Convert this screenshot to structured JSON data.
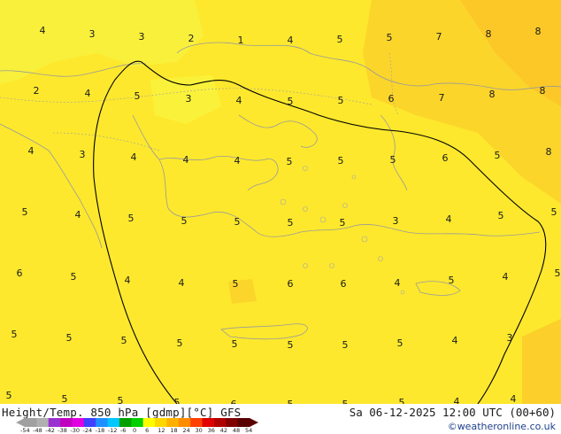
{
  "map": {
    "title": "Height/Temp. 850 hPa [gdmp][°C] GFS",
    "valid_time": "Sa 06-12-2025 12:00 UTC (00+60)",
    "credit": "©weatheronline.co.uk",
    "labels": [
      {
        "t": "4"
      },
      {
        "t": "3"
      },
      {
        "t": "3"
      },
      {
        "t": "2"
      },
      {
        "t": "1"
      },
      {
        "t": "4"
      },
      {
        "t": "5"
      },
      {
        "t": "5"
      },
      {
        "t": "7"
      },
      {
        "t": "8"
      },
      {
        "t": "8"
      },
      {
        "t": "2"
      },
      {
        "t": "4"
      },
      {
        "t": "5"
      },
      {
        "t": "3"
      },
      {
        "t": "4"
      },
      {
        "t": "5"
      },
      {
        "t": "5"
      },
      {
        "t": "6"
      },
      {
        "t": "7"
      },
      {
        "t": "8"
      },
      {
        "t": "8"
      },
      {
        "t": "4"
      },
      {
        "t": "3"
      },
      {
        "t": "4"
      },
      {
        "t": "4"
      },
      {
        "t": "4"
      },
      {
        "t": "5"
      },
      {
        "t": "5"
      },
      {
        "t": "5"
      },
      {
        "t": "6"
      },
      {
        "t": "5"
      },
      {
        "t": "8"
      },
      {
        "t": "5"
      },
      {
        "t": "4"
      },
      {
        "t": "5"
      },
      {
        "t": "5"
      },
      {
        "t": "5"
      },
      {
        "t": "5"
      },
      {
        "t": "5"
      },
      {
        "t": "3"
      },
      {
        "t": "4"
      },
      {
        "t": "5"
      },
      {
        "t": "6"
      },
      {
        "t": "5"
      },
      {
        "t": "4"
      },
      {
        "t": "4"
      },
      {
        "t": "5"
      },
      {
        "t": "6"
      },
      {
        "t": "6"
      },
      {
        "t": "4"
      },
      {
        "t": "5"
      },
      {
        "t": "4"
      },
      {
        "t": "5"
      },
      {
        "t": "5"
      },
      {
        "t": "5"
      },
      {
        "t": "5"
      },
      {
        "t": "5"
      },
      {
        "t": "5"
      },
      {
        "t": "5"
      },
      {
        "t": "5"
      },
      {
        "t": "5"
      },
      {
        "t": "4"
      },
      {
        "t": "3"
      },
      {
        "t": "5"
      },
      {
        "t": "5"
      },
      {
        "t": "5"
      },
      {
        "t": "5"
      },
      {
        "t": "6"
      },
      {
        "t": "5"
      },
      {
        "t": "5"
      },
      {
        "t": "5"
      },
      {
        "t": "4"
      },
      {
        "t": "4"
      },
      {
        "t": "5"
      },
      {
        "t": "6"
      }
    ]
  },
  "legend": {
    "ticks": [
      "-54",
      "-48",
      "-42",
      "-38",
      "-30",
      "-24",
      "-18",
      "-12",
      "-6",
      "0",
      "6",
      "12",
      "18",
      "24",
      "30",
      "36",
      "42",
      "48",
      "54"
    ],
    "colors": [
      "#a0a0a0",
      "#b0b0b0",
      "#9b30d0",
      "#c000c0",
      "#e000e0",
      "#4040ff",
      "#1e90ff",
      "#00c8ff",
      "#00a000",
      "#00d000",
      "#ffff00",
      "#ffd700",
      "#ffb000",
      "#ff8c00",
      "#ff4000",
      "#e00000",
      "#b00000",
      "#800000",
      "#5a0000"
    ]
  }
}
